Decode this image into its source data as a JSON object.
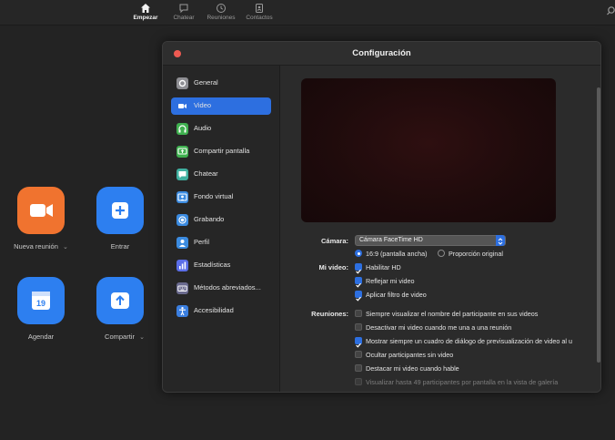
{
  "topnav": {
    "items": [
      {
        "label": "Empezar",
        "icon": "home-icon",
        "active": true
      },
      {
        "label": "Chatear",
        "icon": "chat-icon",
        "active": false
      },
      {
        "label": "Reuniones",
        "icon": "clock-icon",
        "active": false
      },
      {
        "label": "Contactos",
        "icon": "contacts-icon",
        "active": false
      }
    ],
    "search_icon": "search-icon"
  },
  "home": {
    "new_meeting": "Nueva reunión",
    "join": "Entrar",
    "schedule": "Agendar",
    "schedule_day": "19",
    "share": "Compartir",
    "chevron": "⌄",
    "colors": {
      "orange": "#f0732f",
      "blue": "#2d7ff0"
    }
  },
  "settings": {
    "title": "Configuración",
    "sidebar": [
      {
        "label": "General",
        "icon": "gear-icon",
        "color": "#8e8e93"
      },
      {
        "label": "Video",
        "icon": "video-icon",
        "color": "#2d6fe0",
        "active": true
      },
      {
        "label": "Audio",
        "icon": "headphones-icon",
        "color": "#3fb04f"
      },
      {
        "label": "Compartir pantalla",
        "icon": "share-screen-icon",
        "color": "#3fb04f"
      },
      {
        "label": "Chatear",
        "icon": "chat-icon",
        "color": "#3fb0a0"
      },
      {
        "label": "Fondo virtual",
        "icon": "background-icon",
        "color": "#3b8be0"
      },
      {
        "label": "Grabando",
        "icon": "record-icon",
        "color": "#3b8be0"
      },
      {
        "label": "Perfil",
        "icon": "profile-icon",
        "color": "#3b8be0"
      },
      {
        "label": "Estadísticas",
        "icon": "stats-icon",
        "color": "#5b6ee8"
      },
      {
        "label": "Métodos abreviados...",
        "icon": "keyboard-icon",
        "color": "#6a6a8e"
      },
      {
        "label": "Accesibilidad",
        "icon": "accessibility-icon",
        "color": "#3b7fe0"
      }
    ],
    "video": {
      "camera_label": "Cámara:",
      "camera_value": "Cámara FaceTime HD",
      "my_video_label": "Mi video:",
      "ratio_wide": "16:9 (pantalla ancha)",
      "ratio_original": "Proporción original",
      "hd": "Habilitar HD",
      "mirror": "Reflejar mi video",
      "filter": "Aplicar filtro de video",
      "meetings_label": "Reuniones:",
      "meeting_options": [
        {
          "label": "Siempre visualizar el nombre del participante en sus videos",
          "checked": false
        },
        {
          "label": "Desactivar mi video cuando me una a una reunión",
          "checked": false
        },
        {
          "label": "Mostrar siempre un cuadro de diálogo de previsualización de video al u",
          "checked": true
        },
        {
          "label": "Ocultar participantes sin video",
          "checked": false
        },
        {
          "label": "Destacar mi video cuando hable",
          "checked": false
        },
        {
          "label": "Visualizar hasta 49 participantes por pantalla en la vista de galería",
          "checked": false,
          "disabled": true
        }
      ]
    }
  }
}
